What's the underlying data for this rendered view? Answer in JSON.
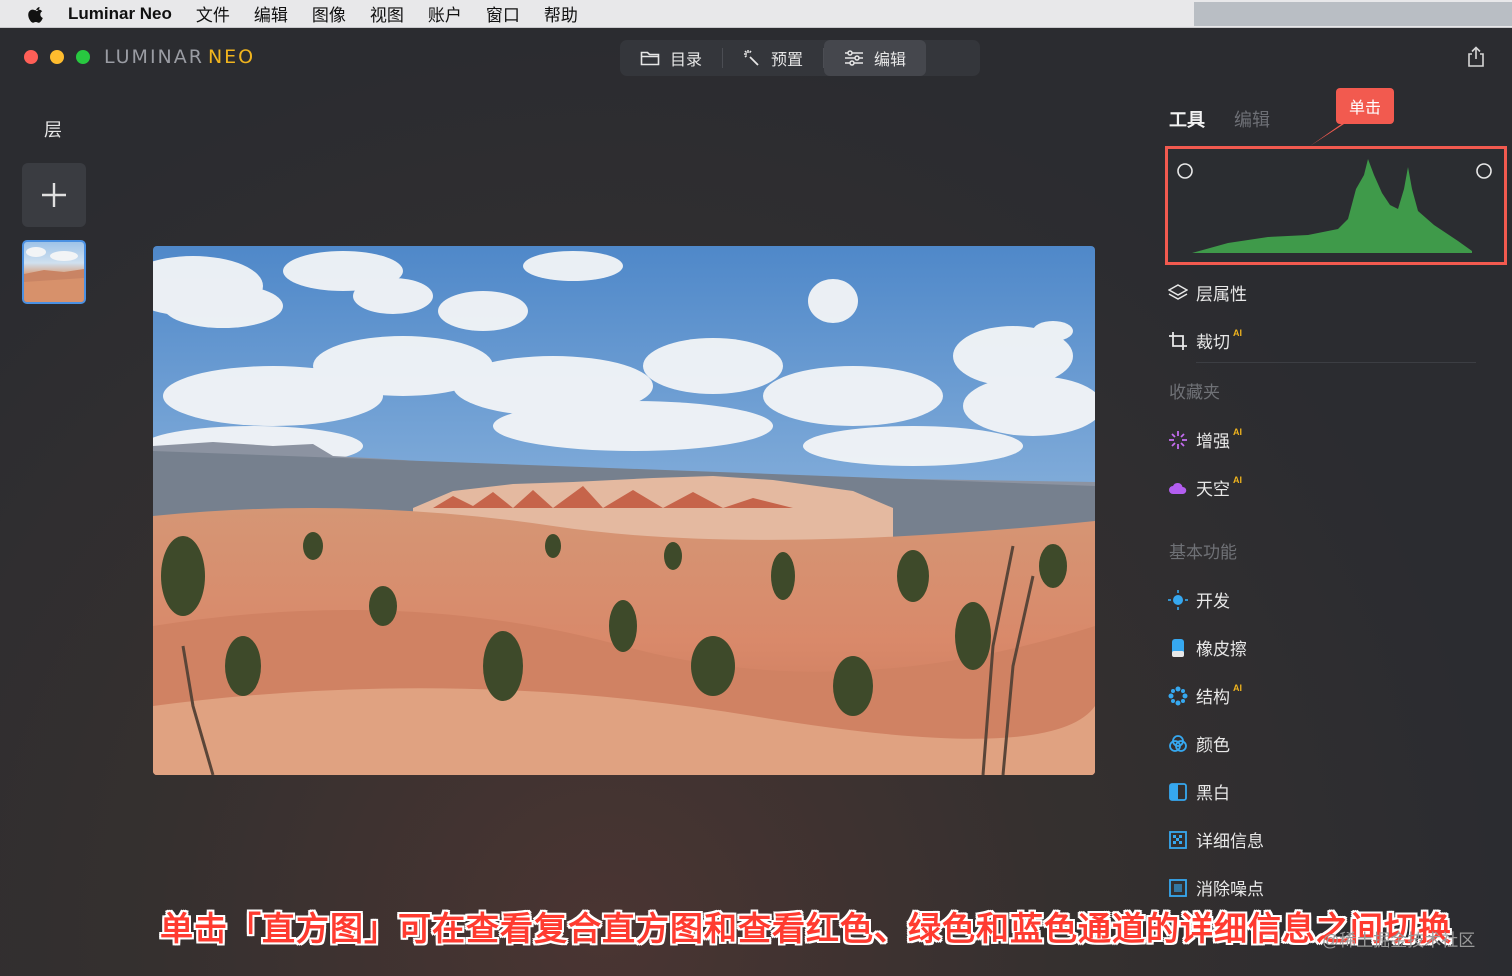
{
  "menubar": {
    "app_name": "Luminar Neo",
    "items": [
      "文件",
      "编辑",
      "图像",
      "视图",
      "账户",
      "窗口",
      "帮助"
    ]
  },
  "window": {
    "logo_main": "LUMINAR",
    "logo_accent": "NEO",
    "tabs": [
      {
        "label": "目录",
        "icon": "folder-icon"
      },
      {
        "label": "预置",
        "icon": "magic-wand-icon"
      },
      {
        "label": "编辑",
        "icon": "sliders-icon",
        "active": true
      }
    ]
  },
  "layers": {
    "title": "层"
  },
  "right_panel": {
    "tab_tools": "工具",
    "tab_edit": "编辑",
    "callout": "单击",
    "items_top": [
      {
        "label": "层属性",
        "icon": "layers-icon",
        "ai": ""
      },
      {
        "label": "裁切",
        "icon": "crop-icon",
        "ai": "AI"
      }
    ],
    "section_favorites": "收藏夹",
    "favorites": [
      {
        "label": "增强",
        "icon": "sparkle-icon",
        "ai": "AI"
      },
      {
        "label": "天空",
        "icon": "cloud-icon",
        "ai": "AI"
      }
    ],
    "section_basic": "基本功能",
    "basic": [
      {
        "label": "开发",
        "icon": "sun-icon",
        "ai": ""
      },
      {
        "label": "橡皮擦",
        "icon": "eraser-icon",
        "ai": ""
      },
      {
        "label": "结构",
        "icon": "structure-icon",
        "ai": "AI"
      },
      {
        "label": "颜色",
        "icon": "color-icon",
        "ai": ""
      },
      {
        "label": "黑白",
        "icon": "bw-icon",
        "ai": ""
      },
      {
        "label": "详细信息",
        "icon": "details-icon",
        "ai": ""
      },
      {
        "label": "消除噪点",
        "icon": "denoise-icon",
        "ai": ""
      }
    ]
  },
  "caption": "单击「直方图」可在查看复合直方图和查看红色、绿色和蓝色通道的详细信息之间切换",
  "watermark": "@稀土掘金技术社区",
  "colors": {
    "accent_red": "#f25a4f",
    "histogram_green": "#3f9a4a",
    "ai_badge": "#f0b41e"
  }
}
